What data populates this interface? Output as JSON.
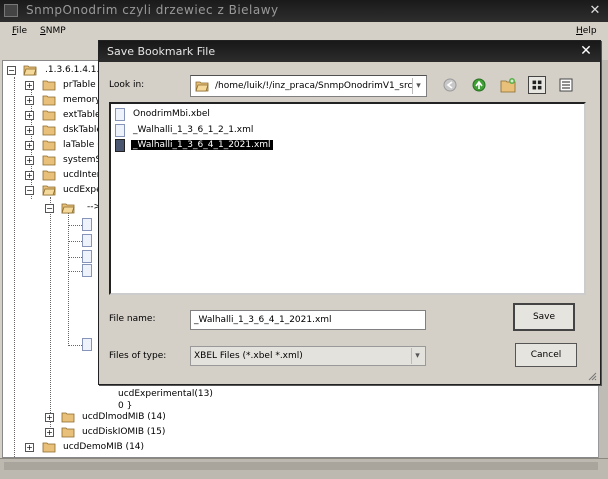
{
  "app": {
    "title": "SnmpOnodrim czyli drzewiec z Bielawy",
    "menu": {
      "file": "File",
      "snmp": "SNMP",
      "help": "Help"
    }
  },
  "tree": {
    "root": ".1.3.6.1.4.1.",
    "items": [
      "prTable",
      "memory",
      "extTable",
      "dskTable",
      "laTable (",
      "systemS",
      "ucdInter",
      "ucdExpe"
    ],
    "sub_label": "-->",
    "after": [
      "ucdExperimental(13)",
      "0 }",
      "ucdDlmodMIB (14)",
      "ucdDiskIOMIB (15)",
      "ucdDemoMIB (14)"
    ]
  },
  "dialog": {
    "title": "Save Bookmark File",
    "look_in_label": "Look in:",
    "look_in_value": "/home/luik/!/inz_praca/SnmpOnodrimV1_src",
    "files": [
      "OnodrimMbi.xbel",
      "_Walhalli_1_3_6_1_2_1.xml",
      "_Walhalli_1_3_6_4_1_2021.xml"
    ],
    "selected_index": 2,
    "file_name_label": "File name:",
    "file_name_value": "_Walhalli_1_3_6_4_1_2021.xml",
    "file_type_label": "Files of type:",
    "file_type_value": "XBEL Files (*.xbel *.xml)",
    "save_label": "Save",
    "cancel_label": "Cancel"
  },
  "colors": {
    "titlebar": "#1c1c1c",
    "folder": "#e8c07a",
    "selection": "#000000"
  }
}
